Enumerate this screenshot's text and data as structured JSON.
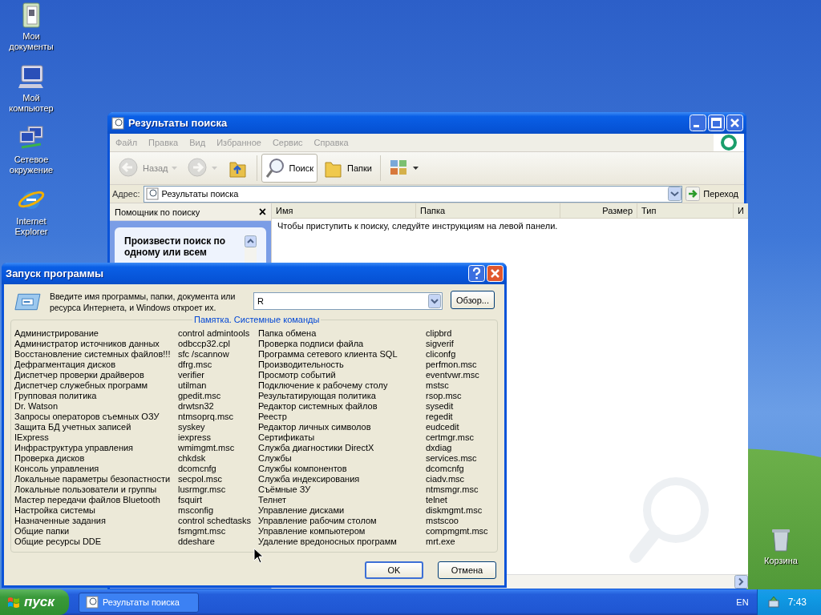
{
  "desktop_icons": [
    {
      "label": "Мои документы",
      "kind": "documents"
    },
    {
      "label": "Мой компьютер",
      "kind": "computer"
    },
    {
      "label": "Сетевое окружение",
      "kind": "network"
    },
    {
      "label": "Internet Explorer",
      "kind": "browser"
    }
  ],
  "recycle_bin": {
    "label": "Корзина"
  },
  "search_window": {
    "title": "Результаты поиска",
    "menu": [
      "Файл",
      "Правка",
      "Вид",
      "Избранное",
      "Сервис",
      "Справка"
    ],
    "toolbar": [
      {
        "kind": "back",
        "label": "Назад",
        "disabled": true,
        "selected": false
      },
      {
        "kind": "forward",
        "disabled": true,
        "selected": false
      },
      {
        "kind": "up",
        "disabled": false,
        "selected": false
      },
      {
        "kind": "search",
        "label": "Поиск",
        "disabled": false,
        "selected": true
      },
      {
        "kind": "folders",
        "label": "Папки",
        "disabled": false,
        "selected": false
      },
      {
        "kind": "views",
        "disabled": false,
        "selected": false
      }
    ],
    "address_label": "Адрес:",
    "address": "Результаты поиска",
    "go_button": "Переход",
    "assistant": {
      "title": "Помощник по поиску",
      "close": "×",
      "card_text": "Произвести поиск по одному или всем"
    },
    "columns": [
      "Имя",
      "Папка",
      "Размер",
      "Тип",
      "И"
    ],
    "message": "Чтобы приступить к поиску, следуйте инструкциям на левой панели."
  },
  "run_dialog": {
    "title": "Запуск программы",
    "description": "Введите имя программы, папки, документа или ресурса Интернета, и Windows откроет их.",
    "input_value": "R",
    "browse_button": "Обзор...",
    "group_title": "Памятка. Системные команды",
    "command_columns": [
      [
        {
          "name": "Администрирование",
          "command": "control admintools"
        },
        {
          "name": "Администратор источников данных",
          "command": "odbccp32.cpl"
        },
        {
          "name": "Восстановление системных файлов!!!",
          "command": "sfc /scannow"
        },
        {
          "name": "Дефрагментация дисков",
          "command": "dfrg.msc"
        },
        {
          "name": "Диспетчер проверки драйверов",
          "command": "verifier"
        },
        {
          "name": "Диспетчер служебных программ",
          "command": "utilman"
        },
        {
          "name": "Групповая политика",
          "command": "gpedit.msc"
        },
        {
          "name": "Dr. Watson",
          "command": "drwtsn32"
        },
        {
          "name": "Запросы операторов съемных ОЗУ",
          "command": "ntmsoprq.msc"
        },
        {
          "name": "Защита БД учетных записей",
          "command": "syskey"
        },
        {
          "name": "IExpress",
          "command": "iexpress"
        },
        {
          "name": "Инфраструктура управления",
          "command": "wmimgmt.msc"
        },
        {
          "name": "Проверка дисков",
          "command": "chkdsk"
        },
        {
          "name": "Консоль управления",
          "command": "dcomcnfg"
        },
        {
          "name": "Локальные параметры безопастности",
          "command": "secpol.msc"
        },
        {
          "name": "Локальные пользователи и группы",
          "command": "lusrmgr.msc"
        },
        {
          "name": "Мастер передачи файлов Bluetooth",
          "command": "fsquirt"
        },
        {
          "name": "Настройка системы",
          "command": "msconfig"
        },
        {
          "name": "Назначенные задания",
          "command": "control schedtasks"
        },
        {
          "name": "Общие папки",
          "command": "fsmgmt.msc"
        },
        {
          "name": "Общие ресурсы DDE",
          "command": "ddeshare"
        }
      ],
      [
        {
          "name": "Папка обмена",
          "command": "clipbrd"
        },
        {
          "name": "Проверка подписи файла",
          "command": "sigverif"
        },
        {
          "name": "Программа сетевого клиента SQL",
          "command": "cliconfg"
        },
        {
          "name": "Производительность",
          "command": "perfmon.msc"
        },
        {
          "name": "Просмотр событий",
          "command": "eventvwr.msc"
        },
        {
          "name": "Подключение к рабочему столу",
          "command": "mstsc"
        },
        {
          "name": "Результатирующая политика",
          "command": "rsop.msc"
        },
        {
          "name": "Редактор системных файлов",
          "command": "sysedit"
        },
        {
          "name": "Реестр",
          "command": "regedit"
        },
        {
          "name": "Редактор личных символов",
          "command": "eudcedit"
        },
        {
          "name": "Сертификаты",
          "command": "certmgr.msc"
        },
        {
          "name": "Служба диагностики DirectX",
          "command": "dxdiag"
        },
        {
          "name": "Службы",
          "command": "services.msc"
        },
        {
          "name": "Службы компонентов",
          "command": "dcomcnfg"
        },
        {
          "name": "Служба индексирования",
          "command": "ciadv.msc"
        },
        {
          "name": "Съёмные ЗУ",
          "command": "ntmsmgr.msc"
        },
        {
          "name": "Телнет",
          "command": "telnet"
        },
        {
          "name": "Управление дисками",
          "command": "diskmgmt.msc"
        },
        {
          "name": "Управление рабочим столом",
          "command": "mstscoo"
        },
        {
          "name": "Управление компьютером",
          "command": "compmgmt.msc"
        },
        {
          "name": "Удаление вредоносных программ",
          "command": "mrt.exe"
        }
      ]
    ],
    "buttons": [
      {
        "label": "OK",
        "default": true
      },
      {
        "label": "Отмена",
        "default": false
      }
    ]
  },
  "taskbar": {
    "start": "пуск",
    "tasks": [
      {
        "label": "Результаты поиска",
        "selected": false
      }
    ],
    "language": "EN",
    "clock": "7:43"
  }
}
